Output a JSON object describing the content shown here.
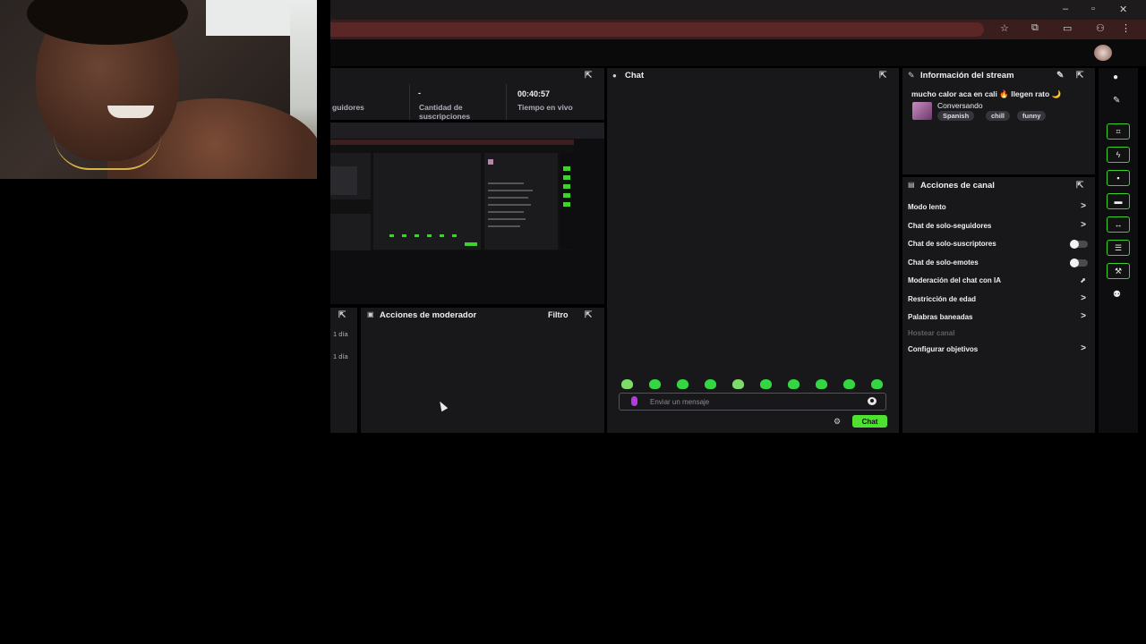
{
  "browser": {
    "window_controls": {
      "minimize": "–",
      "restore": "▫",
      "close": "✕"
    },
    "toolbar_icons": [
      "star-icon",
      "extensions-icon",
      "sidebar-icon",
      "profile-icon",
      "more-icon"
    ]
  },
  "stats": {
    "items": [
      {
        "value": "",
        "label": "guidores"
      },
      {
        "value": "-",
        "label": "Cantidad de suscripciones"
      },
      {
        "value": "00:40:57",
        "label": "Tiempo en vivo"
      }
    ]
  },
  "narrow_panel": {
    "rows": [
      "1 día",
      "1 día"
    ]
  },
  "mod_actions": {
    "title": "Acciones de moderador",
    "filter_label": "Filtro"
  },
  "chat": {
    "title": "Chat",
    "input_placeholder": "Enviar un mensaje",
    "send_label": "Chat",
    "emote_count": 10
  },
  "stream_info": {
    "title": "Información del stream",
    "stream_title": "mucho calor aca en cali 🔥 llegen rato 🌙",
    "category": "Conversando",
    "tags": [
      "Spanish",
      "chill",
      "funny"
    ]
  },
  "channel_actions": {
    "title": "Acciones de canal",
    "items": [
      {
        "label": "Modo lento",
        "control": "chevron"
      },
      {
        "label": "Chat de solo-seguidores",
        "control": "chevron"
      },
      {
        "label": "Chat de solo-suscriptores",
        "control": "toggle",
        "on": false
      },
      {
        "label": "Chat de solo-emotes",
        "control": "toggle",
        "on": false
      },
      {
        "label": "Moderación del chat con IA",
        "control": "trend"
      },
      {
        "label": "Restricción de edad",
        "control": "chevron"
      },
      {
        "label": "Palabras baneadas",
        "control": "chevron"
      },
      {
        "label": "Hostear canal",
        "control": "none",
        "disabled": true
      },
      {
        "label": "Configurar objetivos",
        "control": "chevron"
      }
    ]
  },
  "colors": {
    "accent": "#4fe132",
    "panel_bg": "#18181b",
    "page_bg": "#000000"
  }
}
